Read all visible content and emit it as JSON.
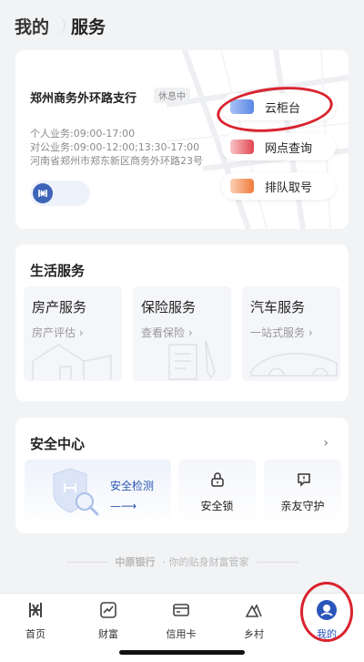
{
  "header": {
    "tabs": [
      {
        "label": "我的"
      },
      {
        "label": "服务"
      }
    ]
  },
  "branch": {
    "name": "郑州商务外环路支行",
    "status": "休息中",
    "lines": [
      "个人业务:09:00-17:00",
      "对公业务:09:00-12:00;13:30-17:00",
      "河南省郑州市郑东新区商务外环路23号"
    ],
    "services": [
      {
        "label": "云柜台",
        "color": "#5b86e5"
      },
      {
        "label": "网点查询",
        "color": "#e2464f"
      },
      {
        "label": "排队取号",
        "color": "#f07a3a"
      }
    ]
  },
  "life": {
    "title": "生活服务",
    "items": [
      {
        "title": "房产服务",
        "sub": "房产评估 ›"
      },
      {
        "title": "保险服务",
        "sub": "查看保险 ›"
      },
      {
        "title": "汽车服务",
        "sub": "一站式服务 ›"
      }
    ]
  },
  "security": {
    "title": "安全中心",
    "chevron": "›",
    "main": {
      "label": "安全检测",
      "arrow": "—⟶"
    },
    "items": [
      {
        "label": "安全锁"
      },
      {
        "label": "亲友守护"
      }
    ]
  },
  "slogan": {
    "brand": "中原银行",
    "text": "· 你的贴身财富管家"
  },
  "tabbar": {
    "items": [
      {
        "label": "首页",
        "icon": "home-icon"
      },
      {
        "label": "财富",
        "icon": "wealth-icon"
      },
      {
        "label": "信用卡",
        "icon": "credit-card-icon"
      },
      {
        "label": "乡村",
        "icon": "village-icon"
      },
      {
        "label": "我的",
        "icon": "profile-icon"
      }
    ],
    "active_color": "#2a55ba"
  },
  "colors": {
    "accent": "#2a55ba",
    "annotation": "#d9232f"
  }
}
